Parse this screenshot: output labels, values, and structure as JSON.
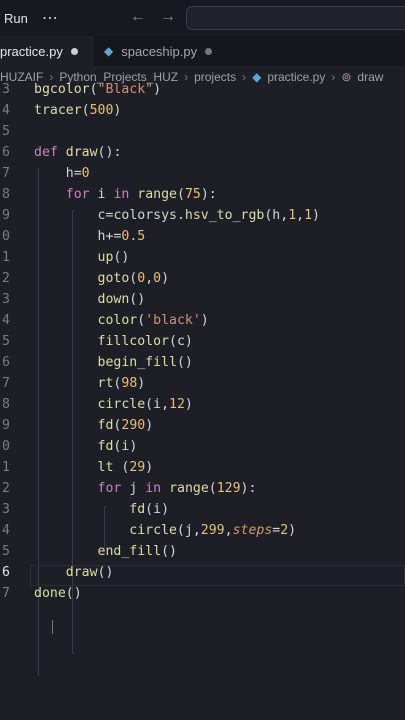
{
  "titlebar": {
    "menu": "Run",
    "more": "⋯",
    "back": "←",
    "forward": "→"
  },
  "tabs": [
    {
      "label": "practice.py",
      "active": true
    },
    {
      "label": "spaceship.py",
      "active": false
    }
  ],
  "breadcrumb": [
    "HUZAIF",
    "Python_Projects_HUZ",
    "projects",
    "practice.py",
    "draw"
  ],
  "code": [
    {
      "n": "3",
      "text": "bgcolor(\"Black\")"
    },
    {
      "n": "4",
      "text": "tracer(500)"
    },
    {
      "n": "5",
      "text": ""
    },
    {
      "n": "6",
      "text": "def draw():"
    },
    {
      "n": "7",
      "text": "    h=0"
    },
    {
      "n": "8",
      "text": "    for i in range(75):"
    },
    {
      "n": "9",
      "text": "        c=colorsys.hsv_to_rgb(h,1,1)"
    },
    {
      "n": "0",
      "text": "        h+=0.5"
    },
    {
      "n": "1",
      "text": "        up()"
    },
    {
      "n": "2",
      "text": "        goto(0,0)"
    },
    {
      "n": "3",
      "text": "        down()"
    },
    {
      "n": "4",
      "text": "        color('black')"
    },
    {
      "n": "5",
      "text": "        fillcolor(c)"
    },
    {
      "n": "6",
      "text": "        begin_fill()"
    },
    {
      "n": "7",
      "text": "        rt(98)"
    },
    {
      "n": "8",
      "text": "        circle(i,12)"
    },
    {
      "n": "9",
      "text": "        fd(290)"
    },
    {
      "n": "0",
      "text": "        fd(i)"
    },
    {
      "n": "1",
      "text": "        lt (29)"
    },
    {
      "n": "2",
      "text": "        for j in range(129):"
    },
    {
      "n": "3",
      "text": "            fd(i)"
    },
    {
      "n": "4",
      "text": "            circle(j,299,steps=2)"
    },
    {
      "n": "5",
      "text": "        end_fill()"
    },
    {
      "n": "6",
      "text": "    draw()"
    },
    {
      "n": "7",
      "text": "done()"
    }
  ]
}
